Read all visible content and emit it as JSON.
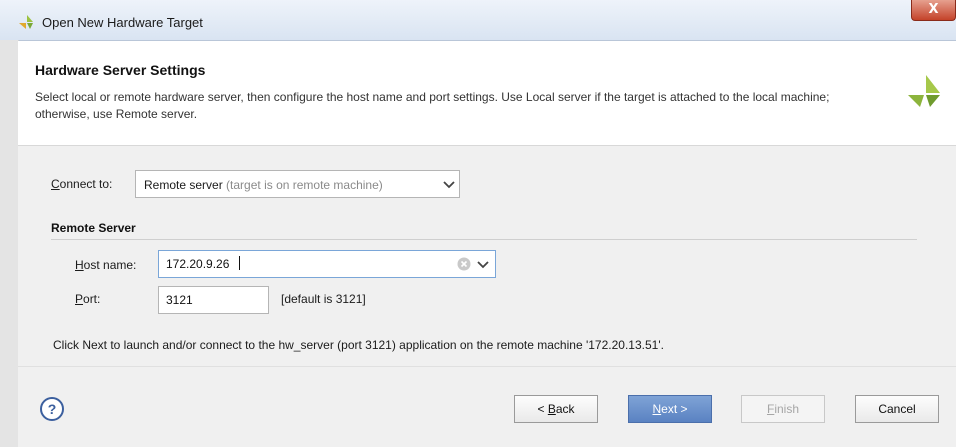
{
  "window": {
    "title": "Open New Hardware Target",
    "close_glyph": "X"
  },
  "header": {
    "title": "Hardware Server Settings",
    "description": "Select local or remote hardware server, then configure the host name and port settings. Use Local server if the target is attached to the local machine; otherwise, use Remote server.",
    "logo_icon": "brand-logo-icon"
  },
  "connect": {
    "label_key": "C",
    "label_rest": "onnect to:",
    "selected": "Remote server",
    "selected_hint": "(target is on remote machine)"
  },
  "remote_server": {
    "title": "Remote Server",
    "host": {
      "label_key": "H",
      "label_rest": "ost name:",
      "value": "172.20.9.26"
    },
    "port": {
      "label_key": "P",
      "label_rest": "ort:",
      "value": "3121",
      "note": "[default is 3121]"
    }
  },
  "info_text": "Click Next to launch and/or connect to the hw_server (port 3121) application on the remote machine '172.20.13.51'.",
  "buttons": {
    "help": "?",
    "back_prefix": "< ",
    "back_key": "B",
    "back_rest": "ack",
    "next_key": "N",
    "next_rest": "ext >",
    "finish_key": "F",
    "finish_rest": "inish",
    "cancel": "Cancel"
  },
  "colors": {
    "accent": "#5a82c2",
    "logo": "#8cb43c",
    "help": "#3b5f9e"
  }
}
